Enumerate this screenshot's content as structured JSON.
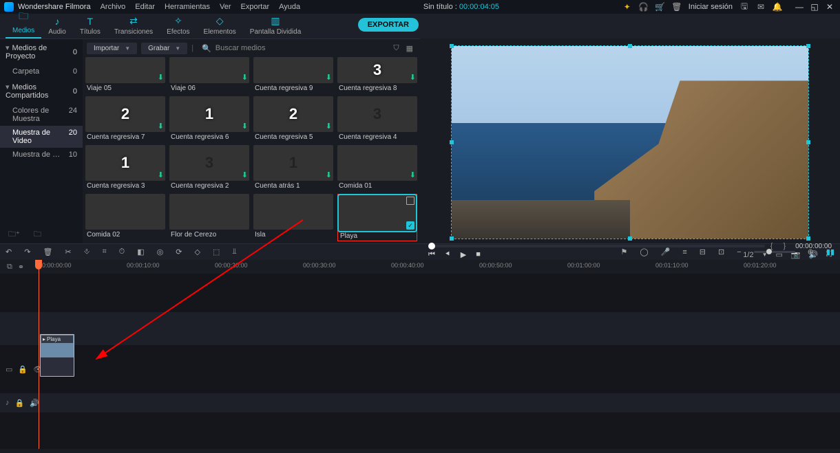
{
  "app": {
    "name": "Wondershare Filmora"
  },
  "menu": [
    "Archivo",
    "Editar",
    "Herramientas",
    "Ver",
    "Exportar",
    "Ayuda"
  ],
  "title": {
    "prefix": "Sin título : ",
    "timecode": "00:00:04:05"
  },
  "account_label": "Iniciar sesión",
  "tabs": [
    {
      "label": "Medios",
      "active": true
    },
    {
      "label": "Audio"
    },
    {
      "label": "Títulos"
    },
    {
      "label": "Transiciones"
    },
    {
      "label": "Efectos"
    },
    {
      "label": "Elementos"
    },
    {
      "label": "Pantalla Dividida"
    }
  ],
  "export_btn": "EXPORTAR",
  "sidebar": {
    "sections": [
      {
        "label": "Medios de Proyecto",
        "count": 0,
        "items": [
          {
            "label": "Carpeta",
            "count": 0
          }
        ]
      },
      {
        "label": "Medios Compartidos",
        "count": 0,
        "items": [
          {
            "label": "Colores de Muestra",
            "count": 24
          },
          {
            "label": "Muestra de Video",
            "count": 20,
            "active": true
          },
          {
            "label": "Muestra de Pantalla Verde",
            "count": 10
          }
        ]
      }
    ]
  },
  "mediabar": {
    "import": "Importar",
    "record": "Grabar",
    "search_placeholder": "Buscar medios"
  },
  "media": [
    {
      "label": "Viaje 05",
      "cls": "th-viaje05",
      "dl": true,
      "short": true
    },
    {
      "label": "Viaje 06",
      "cls": "th-viaje06",
      "dl": true,
      "short": true
    },
    {
      "label": "Cuenta regresiva 9",
      "cls": "th-cr9",
      "dl": true,
      "short": true
    },
    {
      "label": "Cuenta regresiva 8",
      "cls": "th-cr8",
      "dl": true,
      "short": true,
      "num": "3"
    },
    {
      "label": "Cuenta regresiva 7",
      "cls": "th-cr7",
      "dl": true,
      "num": "2"
    },
    {
      "label": "Cuenta regresiva 6",
      "cls": "th-cr6",
      "dl": true,
      "num": "1"
    },
    {
      "label": "Cuenta regresiva 5",
      "cls": "th-cr5",
      "dl": true,
      "num": "2"
    },
    {
      "label": "Cuenta regresiva 4",
      "cls": "th-cr4",
      "num": "3",
      "numdark": true
    },
    {
      "label": "Cuenta regresiva 3",
      "cls": "th-cr3",
      "dl": true,
      "num": "1"
    },
    {
      "label": "Cuenta regresiva 2",
      "cls": "th-cr2",
      "dl": true,
      "num": "3",
      "numdark": true
    },
    {
      "label": "Cuenta atrás 1",
      "cls": "th-ca1",
      "dl": true,
      "num": "1",
      "numdark": true
    },
    {
      "label": "Comida 01",
      "cls": "th-com1",
      "dl": true
    },
    {
      "label": "Comida 02",
      "cls": "th-com2"
    },
    {
      "label": "Flor de Cerezo",
      "cls": "th-flor"
    },
    {
      "label": "Isla",
      "cls": "th-isla"
    },
    {
      "label": "Playa",
      "cls": "th-playa",
      "selected": true,
      "highlighted": true,
      "check": true,
      "sq": true
    }
  ],
  "preview": {
    "timecode": "00:00:00:00",
    "scale_label": "1/2"
  },
  "timeline": {
    "ticks": [
      "00:00:00:00",
      "00:00:10:00",
      "00:00:20:00",
      "00:00:30:00",
      "00:00:40:00",
      "00:00:50:00",
      "00:01:00:00",
      "00:01:10:00",
      "00:01:20:00"
    ],
    "clip_name": "Playa"
  }
}
